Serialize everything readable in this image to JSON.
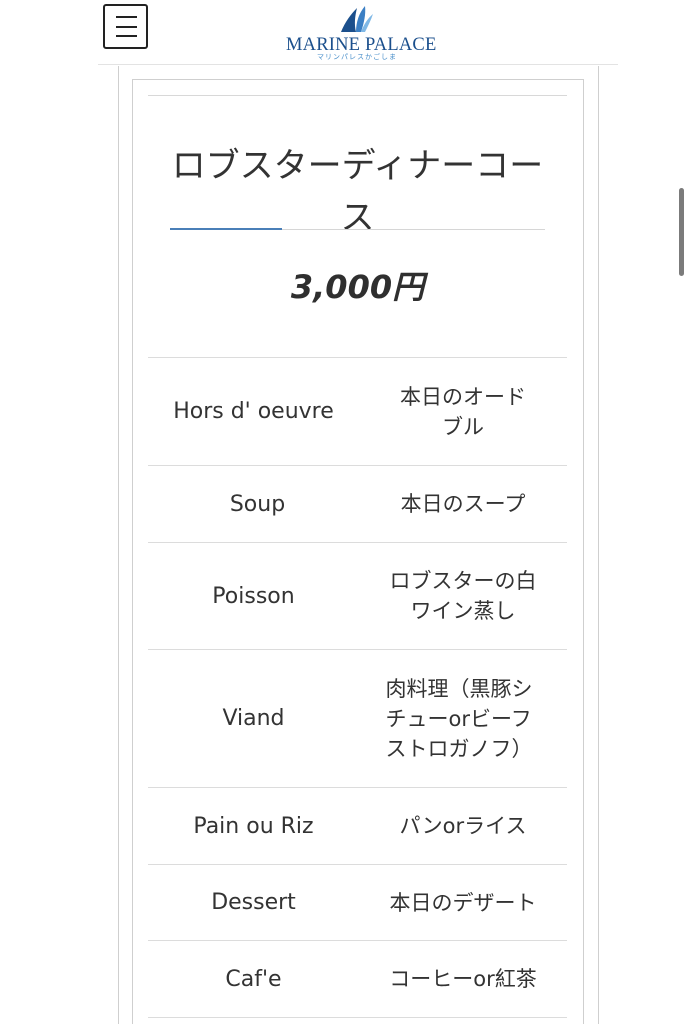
{
  "header": {
    "logo_text": "MARINE PALACE",
    "logo_sub": "マリンパレスかごしま",
    "colors": {
      "logo_navy": "#1b4f8c",
      "logo_light": "#4a8fca"
    }
  },
  "course": {
    "title": "ロブスターディナーコース",
    "price": "3,000円",
    "accent_color": "#4a7fb8"
  },
  "menu": {
    "items": [
      {
        "en": "Hors d' oeuvre",
        "ja": "本日のオードブル"
      },
      {
        "en": "Soup",
        "ja": "本日のスープ"
      },
      {
        "en": "Poisson",
        "ja": "ロブスターの白ワイン蒸し"
      },
      {
        "en": "Viand",
        "ja": "肉料理（黒豚シチューorビーフストロガノフ）"
      },
      {
        "en": "Pain ou Riz",
        "ja": "パンorライス"
      },
      {
        "en": "Dessert",
        "ja": "本日のデザート"
      },
      {
        "en": "Caf'e",
        "ja": "コーヒーor紅茶"
      }
    ]
  }
}
